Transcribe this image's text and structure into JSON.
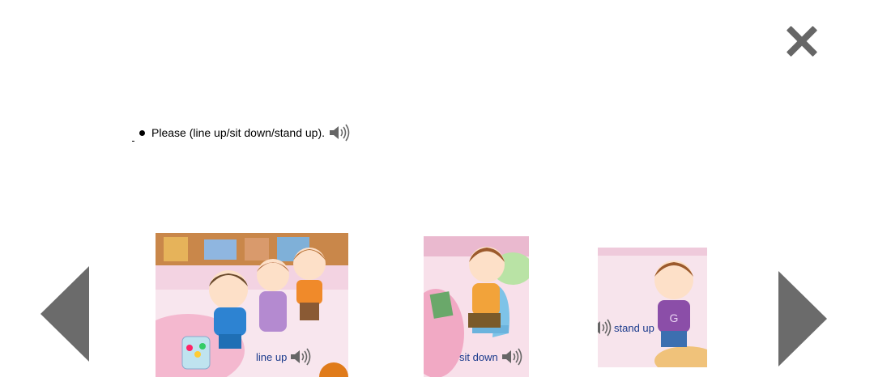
{
  "header": {
    "close_icon": "close-icon"
  },
  "sentence": {
    "text": "Please (line up/sit down/stand up).",
    "audio_icon": "speaker-icon"
  },
  "navigation": {
    "prev_icon": "left-arrow-icon",
    "next_icon": "right-arrow-icon"
  },
  "cards": [
    {
      "label": "line up",
      "audio_icon": "speaker-icon"
    },
    {
      "label": "sit down",
      "audio_icon": "speaker-icon"
    },
    {
      "label": "stand up",
      "audio_icon": "speaker-icon"
    }
  ],
  "colors": {
    "arrow": "#6b6b6b",
    "label_text": "#1a3a8c",
    "speaker": "#666666"
  }
}
